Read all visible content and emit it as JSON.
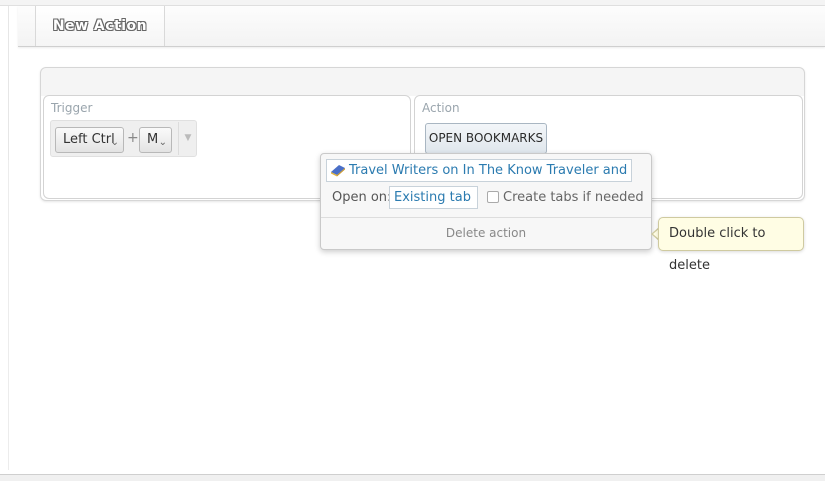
{
  "header": {
    "title": "New Action"
  },
  "trigger": {
    "label": "Trigger",
    "modifier_key": "Left Ctrl",
    "plus": "+",
    "key": "M"
  },
  "action": {
    "label": "Action",
    "type_button": "OPEN BOOKMARKS"
  },
  "popup": {
    "bookmark": "Travel Writers on In The Know Traveler and ...",
    "open_on_label": "Open on:",
    "open_on_value": "Existing tab",
    "create_tabs_label": "Create tabs if needed",
    "create_tabs_checked": false,
    "delete_label": "Delete action"
  },
  "tooltip": {
    "text": "Double click to delete"
  },
  "icons": {
    "bookmark_icon": "bookmark-folder-icon",
    "dropdown_icon": "chevron-down-icon"
  },
  "colors": {
    "link": "#2b7bb0",
    "tooltip_bg": "#fffde4",
    "section_label": "#9aa5ad"
  }
}
